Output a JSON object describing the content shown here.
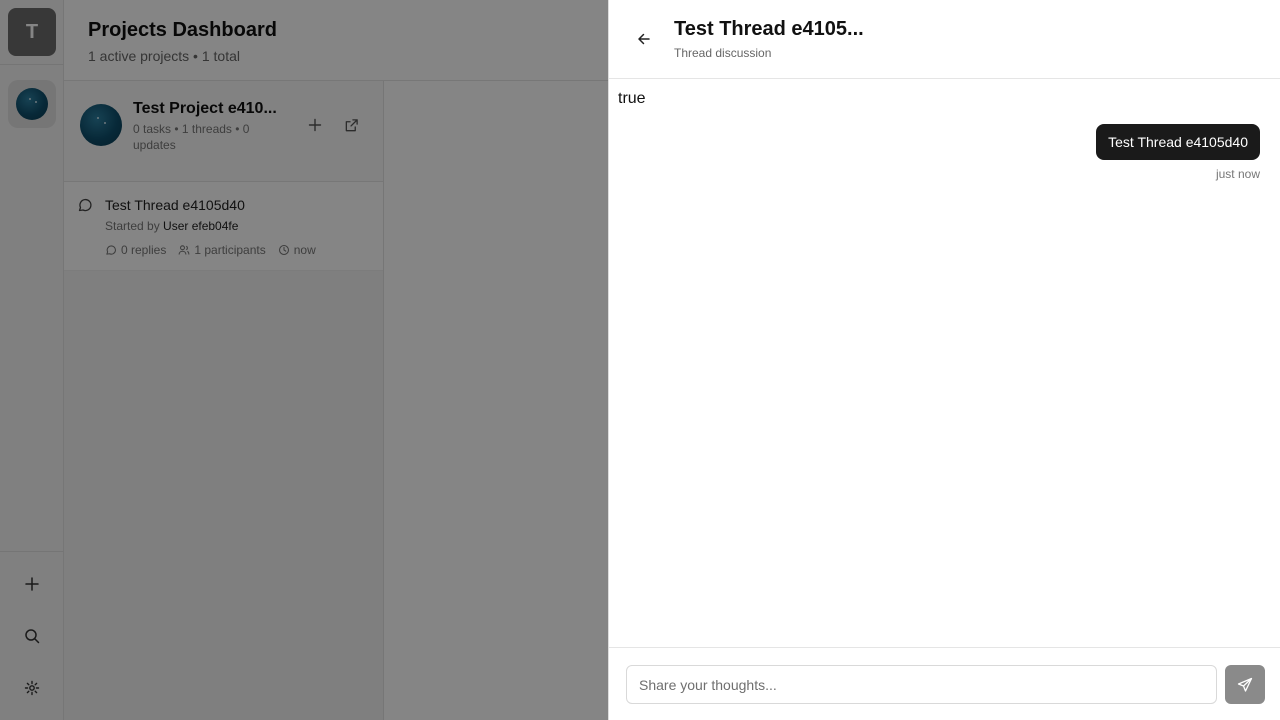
{
  "rail": {
    "workspace_initial": "T"
  },
  "dashboard": {
    "title": "Projects Dashboard",
    "subtitle": "1 active projects • 1 total"
  },
  "project": {
    "name": "Test Project e410...",
    "meta": "0 tasks • 1 threads • 0 updates"
  },
  "thread_card": {
    "title": "Test Thread e4105d40",
    "started_prefix": "Started by ",
    "started_user": "User efeb04fe",
    "replies": "0 replies",
    "participants": "1 participants",
    "time": "now"
  },
  "panel": {
    "title": "Test Thread e4105...",
    "subtitle": "Thread discussion",
    "stray_text": "true",
    "message": "Test Thread e4105d40",
    "message_time": "just now",
    "composer_placeholder": "Share your thoughts..."
  },
  "colors": {
    "overlay": "#000000",
    "bubble": "#1a1a1a",
    "send_button": "#8a8a8a"
  }
}
